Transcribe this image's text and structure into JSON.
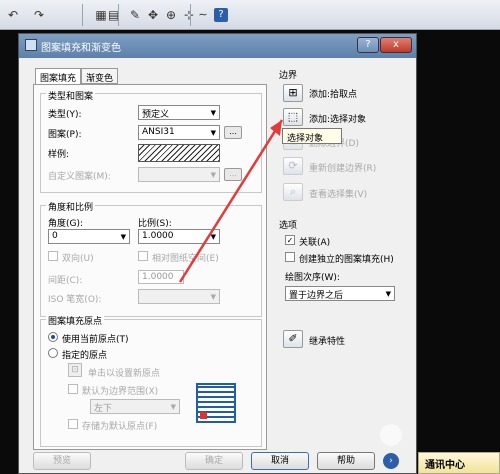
{
  "colors": {
    "accent_arrow": "#e23b3b",
    "title_bar": "#5d80ab",
    "hatch_icon": "#1f5fa8"
  },
  "toolbar": {
    "icons": [
      "undo-icon",
      "redo-icon",
      "table-icon",
      "grid-icon",
      "pen-icon",
      "move-icon",
      "layer-icon",
      "line-icon",
      "dim-icon",
      "help-icon"
    ]
  },
  "dialog": {
    "title": "图案填充和渐变色",
    "help_btn": "?",
    "close_btn": "x",
    "tabs": [
      "图案填充",
      "渐变色"
    ],
    "type_and_pattern": {
      "group_title": "类型和图案",
      "type_label": "类型(Y):",
      "type_value": "预定义",
      "pattern_label": "图案(P):",
      "pattern_value": "ANSI31",
      "browse": "...",
      "sample_label": "样例:",
      "custom_label": "自定义图案(M):",
      "custom_browse": "..."
    },
    "angle_scale": {
      "group_title": "角度和比例",
      "angle_label": "角度(G):",
      "angle_value": "0",
      "scale_label": "比例(S):",
      "scale_value": "1.0000",
      "double_label": "双向(U)",
      "relative_label": "相对图纸空间(E)",
      "spacing_label": "间距(C):",
      "spacing_value": "1.0000",
      "iso_label": "ISO 笔宽(O):"
    },
    "origin": {
      "group_title": "图案填充原点",
      "use_current": "使用当前原点(T)",
      "specified": "指定的原点",
      "click_set": "单击以设置新原点",
      "default_boundary": "默认为边界范围(X)",
      "position_value": "左下",
      "store_default": "存储为默认原点(F)"
    },
    "boundary": {
      "group_title": "边界",
      "add_pick": "添加:拾取点",
      "add_select": "添加:选择对象",
      "remove": "删除边界(D)",
      "recreate": "重新创建边界(R)",
      "view_selection": "查看选择集(V)"
    },
    "tooltip": "选择对象",
    "options": {
      "group_title": "选项",
      "associative": "关联(A)",
      "associative_checked": true,
      "separate": "创建独立的图案填充(H)",
      "separate_checked": false,
      "draw_order_label": "绘图次序(W):",
      "draw_order_value": "置于边界之后"
    },
    "inherit": "继承特性",
    "buttons": {
      "preview": "预览",
      "ok": "确定",
      "cancel": "取消",
      "help": "帮助"
    }
  },
  "notify": {
    "label": "通讯中心"
  }
}
